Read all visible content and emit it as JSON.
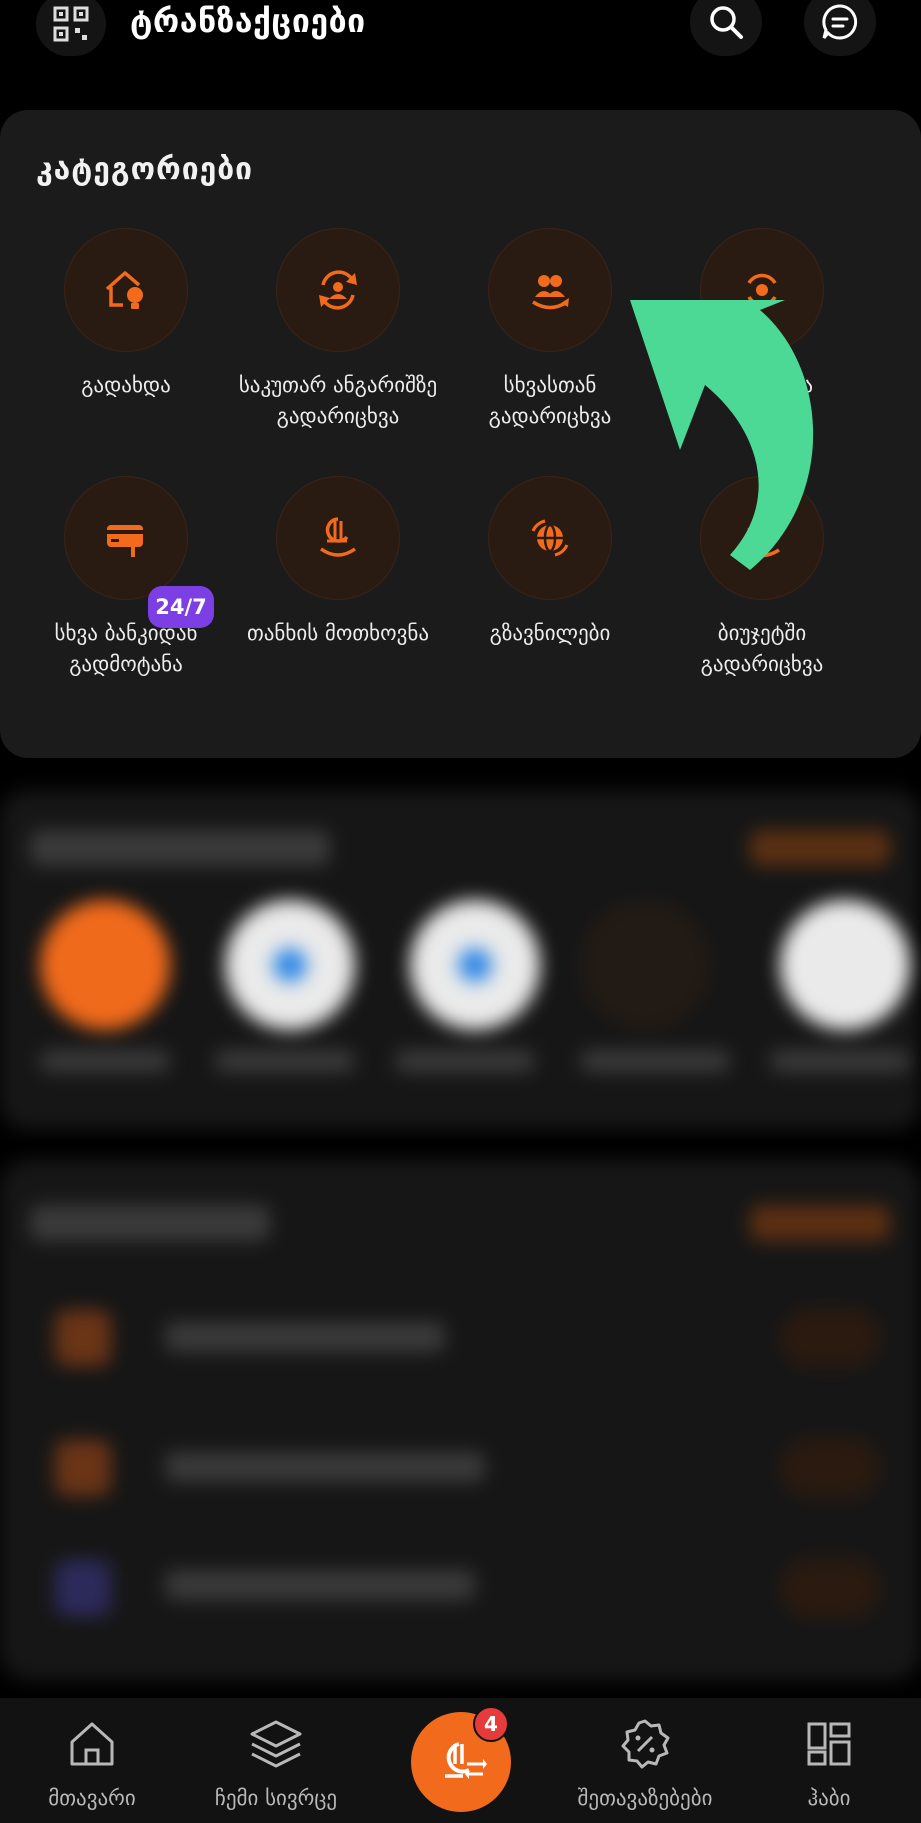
{
  "header": {
    "title": "ტრანზაქციები",
    "qr_icon": "qr-code-icon",
    "search_icon": "search-icon",
    "chat_icon": "chat-icon"
  },
  "categories": {
    "heading": "კატეგორიები",
    "items": [
      {
        "label": "გადახდა",
        "icon": "house-bulb-icon"
      },
      {
        "label": "საკუთარ ანგარიშზე გადარიცხვა",
        "icon": "self-transfer-icon"
      },
      {
        "label": "სხვასთან გადარიცხვა",
        "icon": "people-transfer-icon"
      },
      {
        "label": "...ის ...ცია",
        "icon": "currency-exchange-icon"
      },
      {
        "label": "სხვა ბანკიდან გადმოტანა",
        "icon": "bank-card-upload-icon",
        "badge": "24/7"
      },
      {
        "label": "თანხის მოთხოვნა",
        "icon": "money-request-icon"
      },
      {
        "label": "გზავნილები",
        "icon": "globe-transfer-icon"
      },
      {
        "label": "ბიუჯეტში გადარიცხვა",
        "icon": "budget-transfer-icon"
      }
    ]
  },
  "bottom_nav": {
    "items": [
      {
        "label": "მთავარი",
        "icon": "home-icon"
      },
      {
        "label": "ჩემი სივრცე",
        "icon": "layers-icon"
      },
      {
        "label": "შეთავაზებები",
        "icon": "discount-badge-icon"
      },
      {
        "label": "ჰაბი",
        "icon": "grid-icon"
      }
    ],
    "center_icon": "lari-transfer-icon",
    "center_badge": "4"
  },
  "colors": {
    "accent": "#f26a1c",
    "background": "#000000",
    "card": "#1b1b1b",
    "badge_purple": "#7b3fe4",
    "arrow_green": "#4cd995"
  }
}
